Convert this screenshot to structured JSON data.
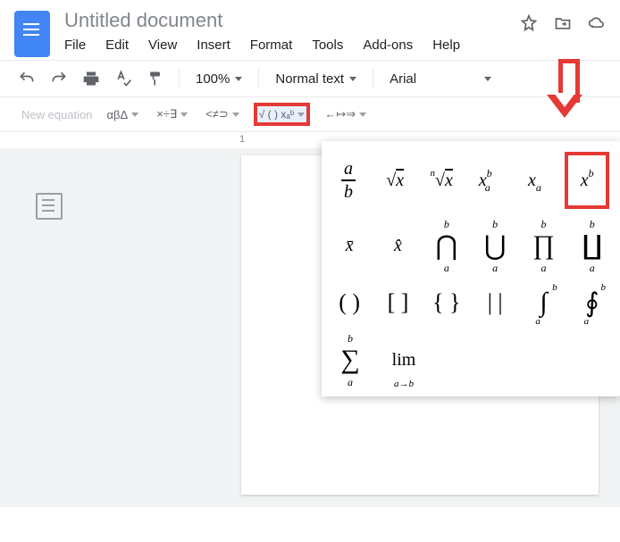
{
  "header": {
    "title": "Untitled document",
    "menus": [
      "File",
      "Edit",
      "View",
      "Insert",
      "Format",
      "Tools",
      "Add-ons",
      "Help"
    ]
  },
  "toolbar": {
    "zoom": "100%",
    "style": "Normal text",
    "font": "Arial"
  },
  "equation_bar": {
    "label": "New equation",
    "groups": {
      "greek": "αβΔ",
      "ops": "×÷∃",
      "rel": "<≠⊃",
      "math": "√ ( ) xₐᵇ",
      "arrows": "←↦⇒"
    }
  },
  "ruler": {
    "mark": "1"
  },
  "math_dropdown": {
    "row1": {
      "frac_num": "a",
      "frac_den": "b",
      "sqrt": "√x",
      "nroot_n": "n",
      "nroot": "√x",
      "xab_x": "x",
      "xab_a": "a",
      "xab_b": "b",
      "xa_x": "x",
      "xa_a": "a",
      "xb_x": "x",
      "xb_b": "b"
    },
    "row2": {
      "xbar": "x̄",
      "xhat": "x̂",
      "cap": "⋂",
      "cup": "⋃",
      "prod": "∏",
      "coprod": "∐",
      "sub": "a",
      "sup": "b"
    },
    "row3": {
      "paren": "( )",
      "brack": "[ ]",
      "brace": "{ }",
      "vert": "| |",
      "int": "∫",
      "oint": "∮",
      "sub": "a",
      "sup": "b"
    },
    "row4": {
      "sum": "∑",
      "sum_sub": "a",
      "sum_sup": "b",
      "lim": "lim",
      "lim_sub": "a→b"
    }
  }
}
